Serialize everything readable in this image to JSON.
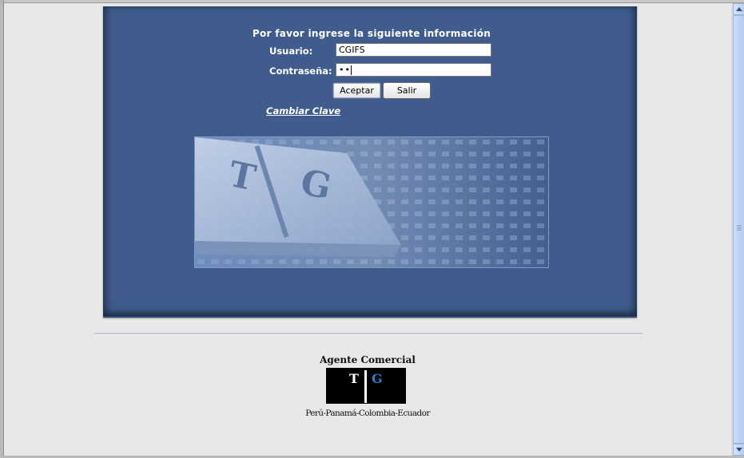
{
  "form": {
    "title": "Por favor ingrese la siguiente información",
    "user_label": "Usuario:",
    "user_value": "CGIFS",
    "password_label": "Contraseña:",
    "password_value": "••",
    "accept_label": "Aceptar",
    "exit_label": "Salir",
    "change_password_link": "Cambiar Clave"
  },
  "logo": {
    "title": "Agente Comercial",
    "letter_left": "T",
    "letter_right": "G",
    "countries": "Perú-Panamá-Colombia-Ecuador"
  },
  "colors": {
    "panel": "#3f5c8c",
    "page_background": "#e6e8ea",
    "logo_g": "#2a7fd4"
  }
}
